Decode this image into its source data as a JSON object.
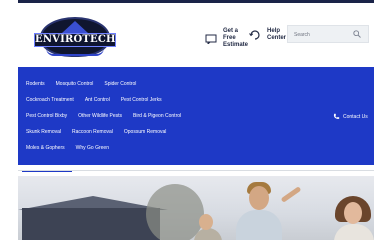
{
  "brand": {
    "name": "ENVIROTECH"
  },
  "header": {
    "estimate_label": "Get a Free Estimate",
    "estimate_icon": "chat-icon",
    "help_label": "Help Center",
    "help_icon": "refresh-headset-icon",
    "search": {
      "placeholder": "Search",
      "icon": "search-icon"
    }
  },
  "nav": {
    "rows": [
      [
        "Rodents",
        "Mosquito Control",
        "Spider Control"
      ],
      [
        "Cockroach Treatment",
        "Ant Control",
        "Pest Control Jerks"
      ],
      [
        "Pest Control Bixby",
        "Other Wildlife Pests",
        "Bird & Pigeon Control"
      ],
      [
        "Skunk Removal",
        "Raccoon Removal",
        "Opossum Removal"
      ],
      [
        "Moles & Gophers",
        "Why Go Green"
      ]
    ],
    "contact_label": "Contact Us",
    "contact_icon": "phone-icon"
  },
  "colors": {
    "nav_bg": "#1e39c6",
    "brand_dark": "#1a2348",
    "search_bg": "#eef1f4"
  }
}
